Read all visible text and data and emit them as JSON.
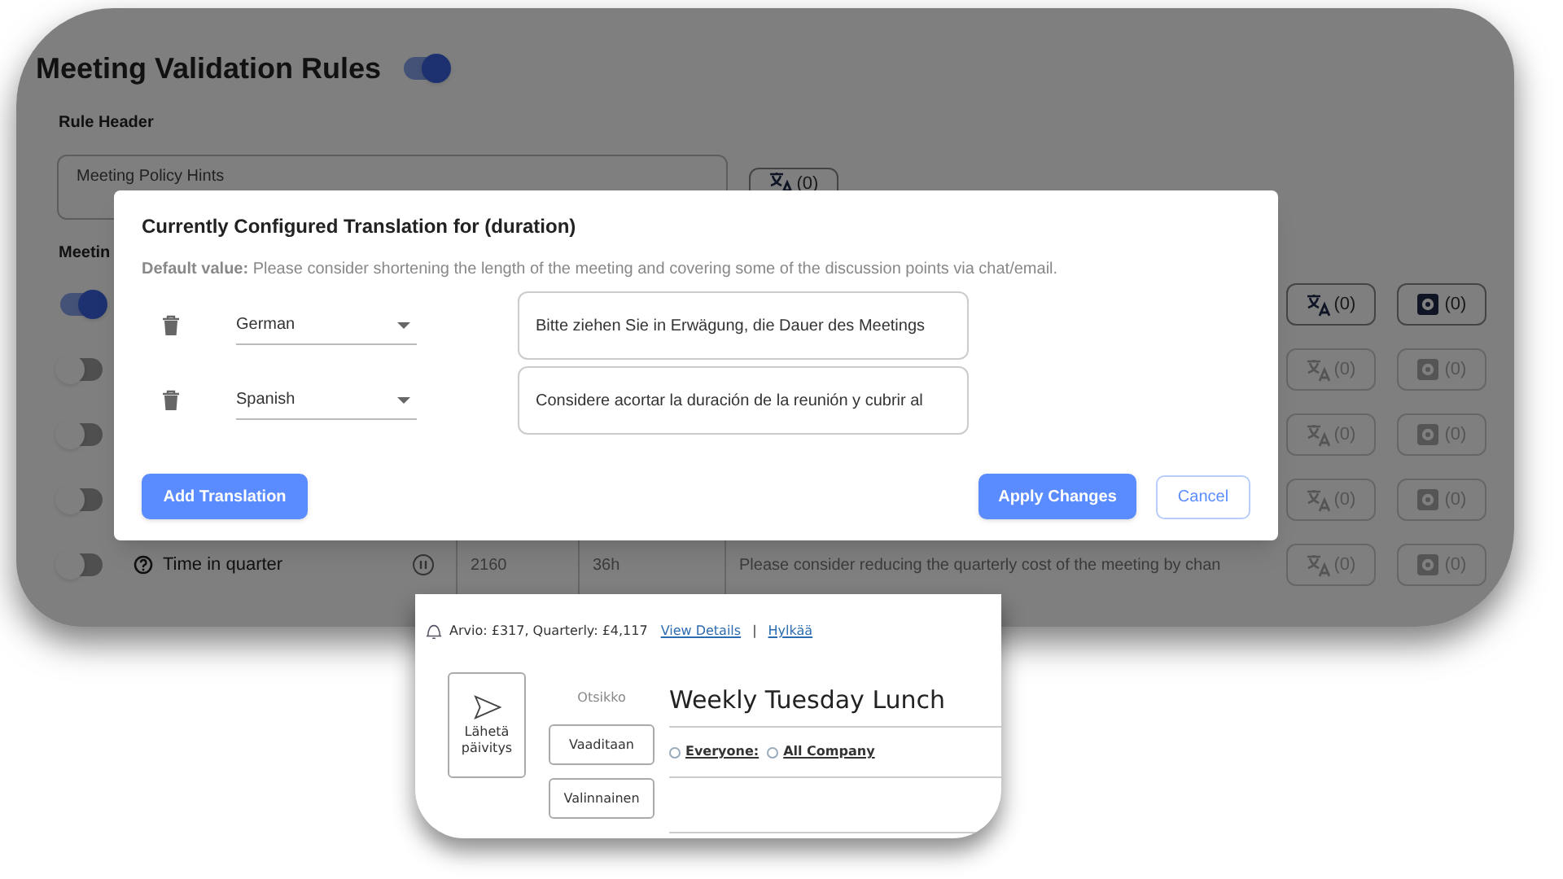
{
  "rules_page": {
    "title": "Meeting Validation Rules",
    "enabled": true,
    "rule_header_label": "Rule Header",
    "rule_header_value": "Meeting Policy Hints",
    "header_translate_count": "(0)",
    "section_label": "Meetin",
    "rules": [
      {
        "on": true,
        "translate_count": "(0)",
        "settings_count": "(0)"
      },
      {
        "on": false,
        "translate_count": "(0)",
        "settings_count": "(0)"
      },
      {
        "on": false,
        "translate_count": "(0)",
        "settings_count": "(0)"
      },
      {
        "on": false,
        "translate_count": "(0)",
        "settings_count": "(0)"
      },
      {
        "on": false,
        "name": "Time in quarter",
        "threshold": "2160",
        "duration": "36h",
        "message": "Please consider reducing the quarterly cost of the meeting by chan",
        "translate_count": "(0)",
        "settings_count": "(0)"
      }
    ]
  },
  "dialog": {
    "title": "Currently Configured Translation for (duration)",
    "default_value": "**Default value:** Please consider shortening the length of the meeting and covering some of the discussion points via chat/email.",
    "translations": [
      {
        "language": "German",
        "text": "Bitte ziehen Sie in Erwägung, die Dauer des Meetings"
      },
      {
        "language": "Spanish",
        "text": "Considere acortar la duración de la reunión y cubrir al"
      }
    ],
    "add_button": "Add Translation",
    "apply_button": "Apply Changes",
    "cancel_button": "Cancel"
  },
  "meeting_card": {
    "estimate": "Arvio: £317, Quarterly: £4,117",
    "details_link": "View Details",
    "separator": "|",
    "dismiss_link": "Hylkää",
    "send_button": "Lähetä päivitys",
    "subject_label": "Otsikko",
    "subject": "Weekly Tuesday Lunch",
    "required_button": "Vaaditaan",
    "optional_button": "Valinnainen",
    "attendees": [
      {
        "name": "Everyone:",
        "selected": false
      },
      {
        "name": "All Company",
        "selected": false
      }
    ]
  }
}
